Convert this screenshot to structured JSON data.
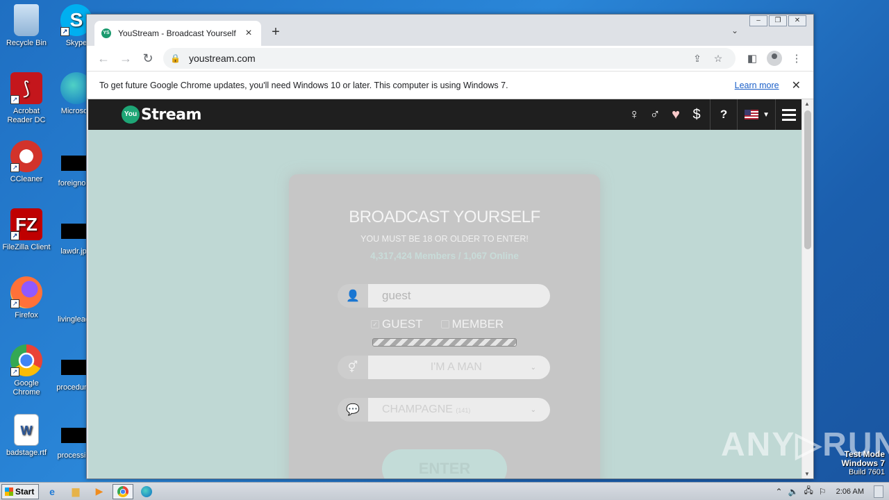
{
  "desktop": {
    "icons": [
      {
        "label": "Recycle Bin",
        "icon": "recycle-bin-icon"
      },
      {
        "label": "Skype",
        "icon": "skype-icon"
      },
      {
        "label": "Acrobat Reader DC",
        "icon": "acrobat-icon"
      },
      {
        "label": "Microsoft",
        "icon": "edge-icon"
      },
      {
        "label": "CCleaner",
        "icon": "ccleaner-icon"
      },
      {
        "label": "foreignoil",
        "icon": "file-icon"
      },
      {
        "label": "FileZilla Client",
        "icon": "filezilla-icon"
      },
      {
        "label": "lawdr.jp",
        "icon": "file-icon"
      },
      {
        "label": "Firefox",
        "icon": "firefox-icon"
      },
      {
        "label": "livinglead",
        "icon": "file-icon"
      },
      {
        "label": "Google Chrome",
        "icon": "chrome-icon"
      },
      {
        "label": "procedure",
        "icon": "file-icon"
      },
      {
        "label": "badstage.rtf",
        "icon": "word-doc-icon"
      },
      {
        "label": "processin",
        "icon": "file-icon"
      }
    ]
  },
  "browser": {
    "tab_title": "YouStream - Broadcast Yourself",
    "favicon_text": "YS",
    "url": "youstream.com",
    "infobar": {
      "message": "To get future Google Chrome updates, you'll need Windows 10 or later. This computer is using Windows 7.",
      "link": "Learn more"
    }
  },
  "site": {
    "logo_you": "You",
    "logo_stream": "Stream",
    "header_icons": [
      "female-icon",
      "male-icon",
      "heart-icon",
      "dollar-icon",
      "help-icon",
      "us-flag-icon",
      "menu-icon"
    ],
    "title": "BROADCAST YOURSELF",
    "subtitle": "YOU MUST BE 18 OR OLDER TO ENTER!",
    "stats": "4,317,424 Members / 1,067 Online",
    "username_value": "guest",
    "radio_guest": "GUEST",
    "radio_member": "MEMBER",
    "gender_value": "I'M A MAN",
    "room_value": "CHAMPAGNE",
    "room_count": "(141)",
    "enter_label": "ENTER"
  },
  "overlay": {
    "watermark": "ANY▷RUN",
    "test_mode_1": "Test Mode",
    "test_mode_2": "Windows 7",
    "test_mode_3": "Build 7601"
  },
  "taskbar": {
    "start_label": "Start",
    "clock": "2:06 AM"
  },
  "colors": {
    "page_bg": "#bfd8d4",
    "header_bg": "#1f1f1f",
    "logo_green": "#1ea676",
    "link": "#1a5fc8"
  }
}
